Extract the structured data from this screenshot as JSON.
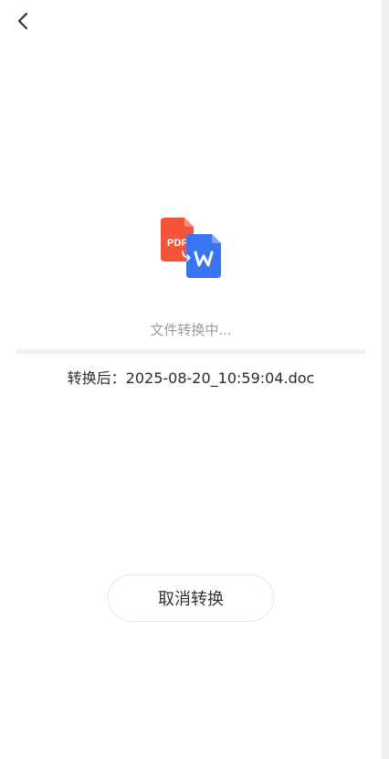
{
  "header": {
    "back_icon": "chevron-left-icon"
  },
  "conversion": {
    "source_icon": "pdf-file-icon",
    "pdf_label": "PDF",
    "target_icon": "word-file-icon",
    "status_text": "文件转换中...",
    "progress_fraction": 0.0,
    "result_line": "转换后：2025-08-20_10:59:04.doc"
  },
  "actions": {
    "cancel_label": "取消转换"
  },
  "colors": {
    "pdf_red": "#f4553a",
    "word_blue": "#3b74f0",
    "status_gray": "#9b9b9b"
  }
}
